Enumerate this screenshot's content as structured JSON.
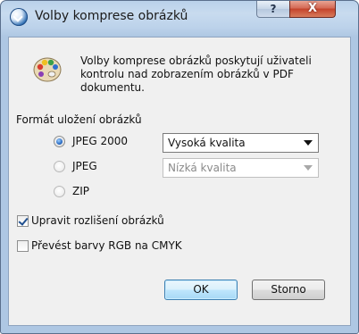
{
  "window": {
    "title": "Volby komprese obrázků",
    "help_label": "?",
    "close_label": "X"
  },
  "info": {
    "text": "Volby komprese obrázků poskytují uživateli kontrolu nad zobrazením obrázků v PDF dokumentu."
  },
  "format": {
    "label": "Formát uložení obrázků",
    "options": [
      {
        "label": "JPEG 2000",
        "selected": true,
        "quality": "Vysoká kvalita"
      },
      {
        "label": "JPEG",
        "selected": false,
        "quality": "Nízká kvalita"
      },
      {
        "label": "ZIP",
        "selected": false
      }
    ]
  },
  "checks": {
    "resize_label": "Upravit rozlišení obrázků",
    "resize_checked": true,
    "cmyk_label": "Převést barvy RGB na CMYK",
    "cmyk_checked": false
  },
  "buttons": {
    "ok_label": "OK",
    "cancel_label": "Storno"
  },
  "colors": {
    "accent": "#2b6cc4",
    "close": "#c4442c"
  }
}
